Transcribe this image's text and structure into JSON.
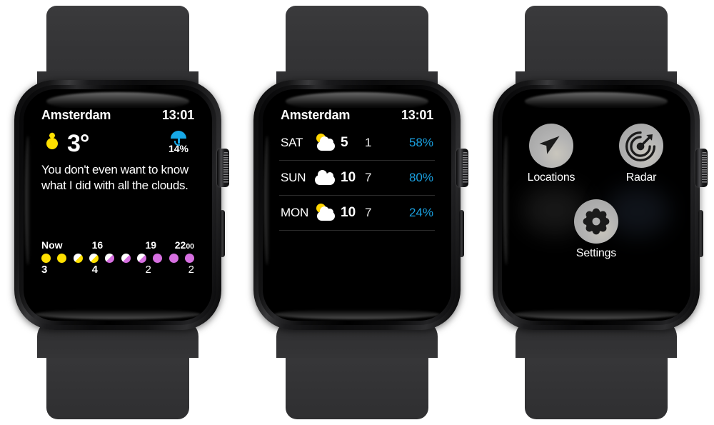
{
  "device": {
    "name": "apple-watch",
    "case_color": "#1a1a1c",
    "band_color": "#333335",
    "count": 3
  },
  "watches": [
    {
      "id": "watch-current-conditions",
      "screen": {
        "header": {
          "location": "Amsterdam",
          "time": "13:01"
        },
        "current": {
          "condition_icon": "sun-icon",
          "temperature": "3°",
          "precip_icon": "umbrella-icon",
          "precip_chance": "14%",
          "precip_color": "#17a9e8",
          "sun_color": "#ffe000"
        },
        "summary": "You don't even want to know what I did with all the clouds.",
        "hourly": {
          "labels": [
            {
              "text": "Now",
              "sub": ""
            },
            {
              "text": "16",
              "sub": ""
            },
            {
              "text": "19",
              "sub": ""
            },
            {
              "text": "22",
              "sub": "00"
            }
          ],
          "dots": [
            {
              "style": "solid",
              "color": "#ffe000"
            },
            {
              "style": "solid",
              "color": "#ffe000"
            },
            {
              "style": "half",
              "color": "#ffe000"
            },
            {
              "style": "half",
              "color": "#ffe000"
            },
            {
              "style": "half",
              "color": "#d66fe0"
            },
            {
              "style": "half",
              "color": "#d66fe0"
            },
            {
              "style": "half",
              "color": "#d66fe0"
            },
            {
              "style": "solid",
              "color": "#d66fe0"
            },
            {
              "style": "solid",
              "color": "#d66fe0"
            },
            {
              "style": "solid",
              "color": "#d66fe0"
            }
          ],
          "values": [
            {
              "text": "3",
              "bold": true
            },
            {
              "text": "4",
              "bold": true
            },
            {
              "text": "2",
              "bold": false
            },
            {
              "text": "2",
              "bold": false
            }
          ]
        }
      }
    },
    {
      "id": "watch-daily-forecast",
      "screen": {
        "header": {
          "location": "Amsterdam",
          "time": "13:01"
        },
        "days": [
          {
            "name": "SAT",
            "icon": "sun-behind-cloud-icon",
            "high": "5",
            "low": "1",
            "precip": "58%"
          },
          {
            "name": "SUN",
            "icon": "cloud-icon",
            "high": "10",
            "low": "7",
            "precip": "80%"
          },
          {
            "name": "MON",
            "icon": "sun-behind-cloud-icon",
            "high": "10",
            "low": "7",
            "precip": "24%"
          }
        ],
        "precip_color": "#1aa0e0"
      }
    },
    {
      "id": "watch-menu",
      "screen": {
        "items": [
          {
            "label": "Locations",
            "icon": "navigation-arrow-icon"
          },
          {
            "label": "Radar",
            "icon": "radar-target-icon"
          },
          {
            "label": "Settings",
            "icon": "gear-icon"
          }
        ],
        "circle_color": "#b3b3b3"
      }
    }
  ]
}
